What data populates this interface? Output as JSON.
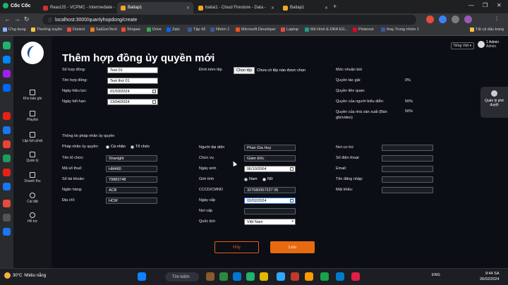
{
  "browser": {
    "brand": "Cốc Cốc",
    "tabs": [
      {
        "label": "ReactJS - VCPMC - Intermediate -",
        "color": "#d32f2f",
        "active": false
      },
      {
        "label": "Baitap1",
        "color": "#f5a623",
        "active": true
      },
      {
        "label": "baitai1 - Cloud Firestore - Data -",
        "color": "#f5a623",
        "active": false
      },
      {
        "label": "Baitap1",
        "color": "#f5a623",
        "active": false
      }
    ],
    "url": "localhost:3000/quanlyhopdong/create",
    "bookmarks": [
      "Ứng dụng",
      "Thưởng xuyên",
      "Donimi",
      "SaiGonTech",
      "Shopee",
      "Drive",
      "Zalo",
      "Tập 43",
      "Nhóm 1",
      "Microsoft Developer",
      "Laptop",
      "Mô Hình E-DRA EG...",
      "Pinterest",
      "thay Trung nhóm 1",
      "Tất cả dấu trang"
    ]
  },
  "sidebar": {
    "items": [
      {
        "label": "Kho bản ghi",
        "icon": "archive-icon"
      },
      {
        "label": "Playlist",
        "icon": "playlist-icon"
      },
      {
        "label": "Lập lịch phát",
        "icon": "calendar-icon"
      },
      {
        "label": "Quản lý",
        "icon": "manage-icon"
      },
      {
        "label": "Doanh thu",
        "icon": "revenue-icon"
      },
      {
        "label": "Cài đặt",
        "icon": "gear-icon"
      },
      {
        "label": "Hỗ trợ",
        "icon": "help-icon"
      }
    ]
  },
  "header": {
    "language": "Tiếng Việt",
    "user_name": "1 Admin",
    "user_role": "Admin"
  },
  "page": {
    "title": "Thêm hợp đồng ủy quyền mới"
  },
  "contract": {
    "number_label": "Số hợp đồng:",
    "number_value": "Test 01",
    "name_label": "Tên hợp đồng:",
    "name_value": "Test thứ 01",
    "effective_label": "Ngày hiệu lực:",
    "effective_value": "01/03/2024",
    "expiry_label": "Ngày hết hạn:",
    "expiry_value": "13/04/2024",
    "attach_label": "Đính kèm tệp",
    "attach_button": "Chọn tệp",
    "attach_status": "Chưa có tệp nào được chọn",
    "royalty_title": "Mức nhuận bút",
    "author_right_label": "Quyền tác giả:",
    "author_right_value": "0%",
    "related_right_label": "Quyền liên quan:",
    "performer_right_label": "Quyền của người biểu diễn:",
    "performer_right_value": "50%",
    "producer_right_label": "Quyền của nhà sản xuất (Bản ghi/video)",
    "producer_right_value": "50%"
  },
  "entity": {
    "section_title": "Thông tin pháp nhân ủy quyền",
    "type_label": "Pháp nhân ủy quyền:",
    "type_options": [
      "Cá nhân",
      "Tổ chức"
    ],
    "type_selected": "Tổ chức",
    "org_name_label": "Tên tổ chức:",
    "org_name_value": "Shanight",
    "tax_label": "Mã số thuế:",
    "tax_value": "HM480",
    "account_label": "Số tài khoản:",
    "account_value": "79883748",
    "bank_label": "Ngân hàng:",
    "bank_value": "ACB",
    "address_label": "Địa chỉ:",
    "address_value": "HCM",
    "rep_label": "Người đại diện",
    "rep_value": "Phan Gia Huy",
    "position_label": "Chức vụ",
    "position_value": "Giám Đốc",
    "dob_label": "Ngày sinh",
    "dob_value": "06/10/2004",
    "gender_label": "Giới tính",
    "gender_options": [
      "Nam",
      "Nữ"
    ],
    "gender_selected": "Nam",
    "id_label": "CCCD/CMND",
    "id_value": "327580957227 05",
    "issue_date_label": "Ngày cấp",
    "issue_date_value": "02/02/2024",
    "issue_place_label": "Nơi cấp",
    "issue_place_value": "",
    "nationality_label": "Quốc tịch",
    "nationality_value": "Việt Nam",
    "residence_label": "Nơi cư trú",
    "phone_label": "Số điện thoại:",
    "email_label": "Email:",
    "username_label": "Tên đăng nhập:",
    "password_label": "Mật khẩu:"
  },
  "actions": {
    "cancel": "Hủy",
    "save": "Lưu"
  },
  "chat": {
    "label": "Quản lý phê duyệt"
  },
  "taskbar": {
    "weather_temp": "30°C",
    "weather_desc": "Nhiều nắng",
    "search": "Tìm kiếm",
    "lang": "ENG",
    "time": "9:44 SA",
    "date": "26/02/2024"
  }
}
